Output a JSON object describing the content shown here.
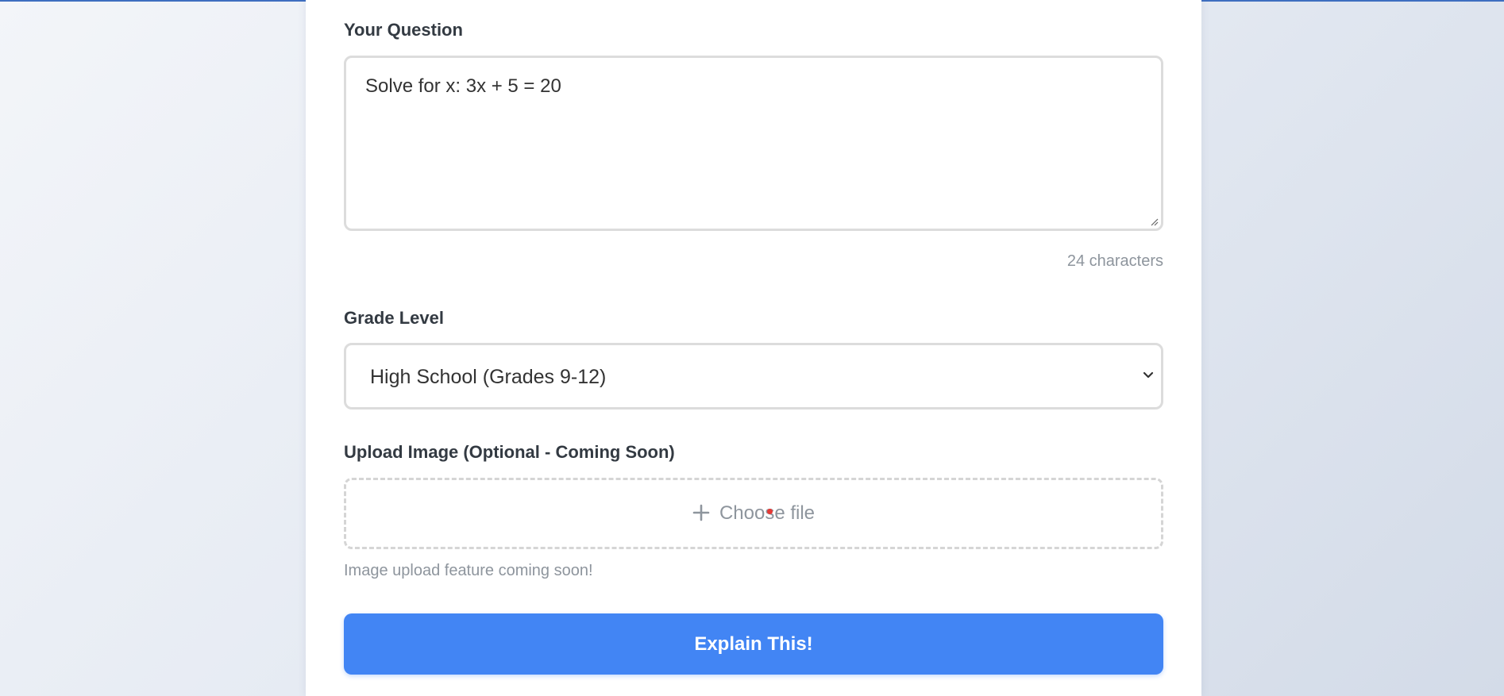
{
  "form": {
    "question_label": "Your Question",
    "question_value": "Solve for x: 3x + 5 = 20",
    "char_count": "24 characters",
    "grade_label": "Grade Level",
    "grade_value": "High School (Grades 9-12)",
    "upload_label": "Upload Image (Optional - Coming Soon)",
    "upload_button": "Choose file",
    "upload_hint": "Image upload feature coming soon!",
    "submit_label": "Explain This!"
  },
  "icons": {
    "plus": "plus-icon",
    "chevron": "chevron-down-icon",
    "resize": "resize-handle-icon"
  },
  "colors": {
    "accent": "#4285f4",
    "top_line": "#3e6ec0",
    "muted_text": "#8e959d",
    "cursor": "#e53935"
  }
}
